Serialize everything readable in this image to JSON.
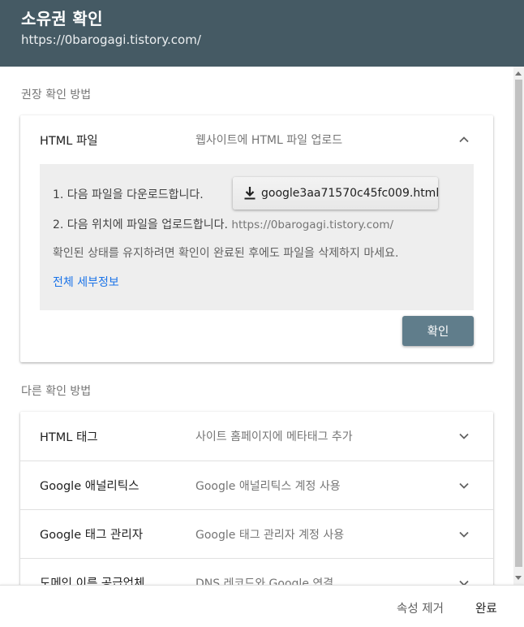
{
  "header": {
    "title": "소유권 확인",
    "subtitle": "https://0barogagi.tistory.com/"
  },
  "recommended": {
    "label": "권장 확인 방법",
    "method": {
      "title": "HTML 파일",
      "description": "웹사이트에 HTML 파일 업로드",
      "icon": "chevron-up-icon",
      "steps": {
        "step1": "1. 다음 파일을 다운로드합니다.",
        "download_file": "google3aa71570c45fc009.html",
        "step2": "2. 다음 위치에 파일을 업로드합니다.",
        "upload_url": "https://0barogagi.tistory.com/",
        "note": "확인된 상태를 유지하려면 확인이 완료된 후에도 파일을 삭제하지 마세요.",
        "details_link": "전체 세부정보"
      },
      "verify_label": "확인"
    }
  },
  "other": {
    "label": "다른 확인 방법",
    "methods": [
      {
        "title": "HTML 태그",
        "description": "사이트 홈페이지에 메타태그 추가",
        "icon": "chevron-down-icon"
      },
      {
        "title": "Google 애널리틱스",
        "description": "Google 애널리틱스 계정 사용",
        "icon": "chevron-down-icon"
      },
      {
        "title": "Google 태그 관리자",
        "description": "Google 태그 관리자 계정 사용",
        "icon": "chevron-down-icon"
      },
      {
        "title": "도메인 이름 공급업체",
        "description": "DNS 레코드와 Google 연결",
        "icon": "chevron-down-icon"
      }
    ]
  },
  "footer": {
    "remove_label": "속성 제거",
    "done_label": "완료"
  },
  "colors": {
    "header_bg": "#455a64",
    "verify_button": "#607d8b",
    "link": "#1a73e8",
    "panel_bg": "#eeeeee"
  }
}
